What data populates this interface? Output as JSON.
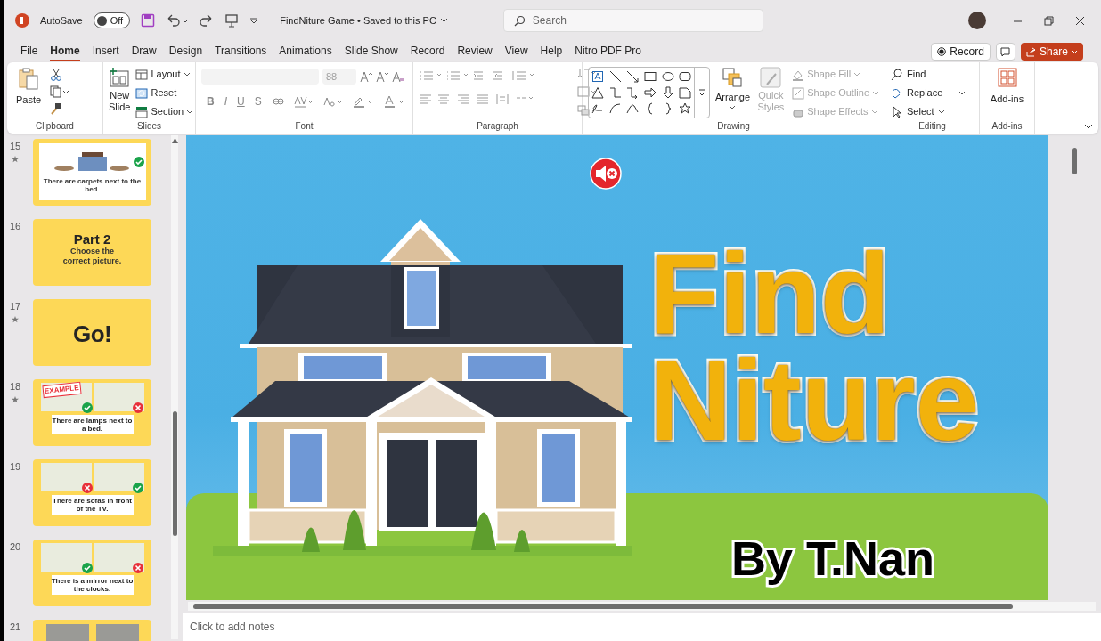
{
  "title_bar": {
    "autosave_label": "AutoSave",
    "autosave": {
      "on": false,
      "label": "Off"
    },
    "document_title": "FindNiture Game • Saved to this PC",
    "search": {
      "placeholder": "Search"
    }
  },
  "menu_tabs": [
    {
      "label": "File",
      "selected": false
    },
    {
      "label": "Home",
      "selected": true
    },
    {
      "label": "Insert",
      "selected": false
    },
    {
      "label": "Draw",
      "selected": false
    },
    {
      "label": "Design",
      "selected": false
    },
    {
      "label": "Transitions",
      "selected": false
    },
    {
      "label": "Animations",
      "selected": false
    },
    {
      "label": "Slide Show",
      "selected": false
    },
    {
      "label": "Record",
      "selected": false
    },
    {
      "label": "Review",
      "selected": false
    },
    {
      "label": "View",
      "selected": false
    },
    {
      "label": "Help",
      "selected": false
    },
    {
      "label": "Nitro PDF Pro",
      "selected": false
    }
  ],
  "record_button": "Record",
  "share_button": "Share",
  "ribbon": {
    "clipboard": {
      "label": "Clipboard",
      "paste": "Paste"
    },
    "slides": {
      "label": "Slides",
      "new_slide": "New Slide",
      "items": [
        "Layout",
        "Reset",
        "Section"
      ]
    },
    "font": {
      "label": "Font",
      "size": "88",
      "format_glyphs": [
        "B",
        "I",
        "U",
        "S"
      ]
    },
    "paragraph": {
      "label": "Paragraph"
    },
    "drawing": {
      "label": "Drawing",
      "arrange": "Arrange",
      "quick_styles": {
        "label": "Quick Styles",
        "disabled": true
      },
      "shape_items": [
        {
          "label": "Shape Fill",
          "disabled": true
        },
        {
          "label": "Shape Outline",
          "disabled": true
        },
        {
          "label": "Shape Effects",
          "disabled": true
        }
      ]
    },
    "editing": {
      "label": "Editing",
      "items": [
        "Find",
        "Replace",
        "Select"
      ]
    },
    "addins": {
      "label": "Add-ins",
      "button": "Add-ins"
    }
  },
  "thumbnails": [
    {
      "number": "15",
      "animated": true,
      "kind": "picture",
      "caption": "There are carpets next to the bed."
    },
    {
      "number": "16",
      "animated": false,
      "kind": "title",
      "heading": "Part 2",
      "caption": "Choose the correct picture."
    },
    {
      "number": "17",
      "animated": true,
      "kind": "go",
      "heading": "Go!"
    },
    {
      "number": "18",
      "animated": true,
      "kind": "compare",
      "tag": "EXAMPLE",
      "caption": "There are lamps next to a bed."
    },
    {
      "number": "19",
      "animated": false,
      "kind": "compare",
      "caption": "There are sofas in front of the TV."
    },
    {
      "number": "20",
      "animated": false,
      "kind": "compare",
      "caption": "There is a mirror next to the clocks."
    },
    {
      "number": "21",
      "animated": false,
      "kind": "partial"
    }
  ],
  "slide": {
    "title_lines": [
      "Find",
      "Niture"
    ],
    "byline": "By T.Nan"
  },
  "notes": {
    "placeholder": "Click to add notes"
  }
}
